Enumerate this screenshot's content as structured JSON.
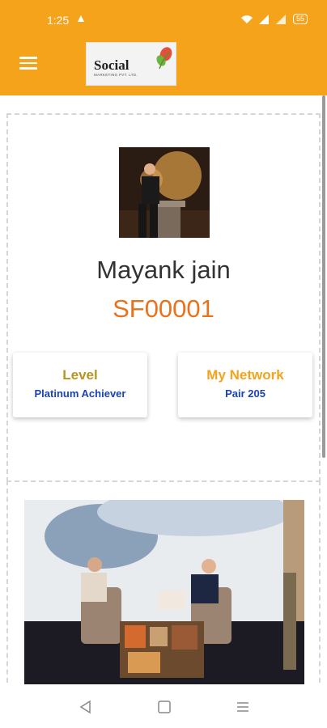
{
  "status_bar": {
    "time": "1:25",
    "battery": "55"
  },
  "app_bar": {
    "logo_text": "Social",
    "logo_subtext": "MARKETING PVT. LTD."
  },
  "profile": {
    "name": "Mayank jain",
    "id": "SF00001"
  },
  "stats": [
    {
      "title": "Level",
      "value": "Platinum Achiever",
      "title_color": "#b79521"
    },
    {
      "title": "My Network",
      "value": "Pair 205",
      "title_color": "#f4a31b"
    }
  ],
  "colors": {
    "brand": "#f4a31b",
    "id_orange": "#e8731c",
    "value_blue": "#1a43b8"
  },
  "icons": [
    "menu-icon",
    "wifi-icon",
    "signal-icon",
    "battery-icon",
    "back-icon",
    "home-icon",
    "recents-icon"
  ]
}
